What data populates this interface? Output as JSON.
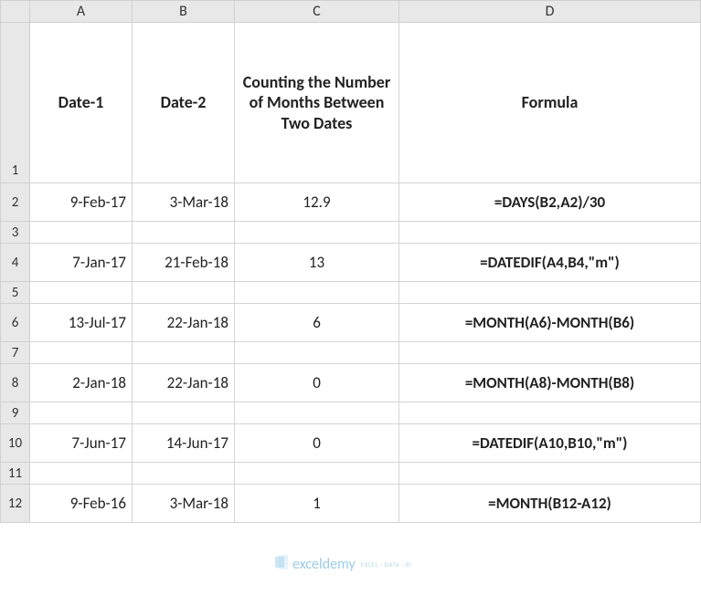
{
  "columns": {
    "rowhead": "",
    "A": "A",
    "B": "B",
    "C": "C",
    "D": "D"
  },
  "header": {
    "A": "Date-1",
    "B": "Date-2",
    "C": "Counting the Number of Months Between Two Dates",
    "D": "Formula"
  },
  "rows": [
    {
      "n": "1",
      "type": "header"
    },
    {
      "n": "2",
      "type": "data",
      "A": "9-Feb-17",
      "B": "3-Mar-18",
      "C": "12.9",
      "D": "=DAYS(B2,A2)/30"
    },
    {
      "n": "3",
      "type": "empty"
    },
    {
      "n": "4",
      "type": "data",
      "A": "7-Jan-17",
      "B": "21-Feb-18",
      "C": "13",
      "D": "=DATEDIF(A4,B4,\"m\")"
    },
    {
      "n": "5",
      "type": "empty"
    },
    {
      "n": "6",
      "type": "data",
      "A": "13-Jul-17",
      "B": "22-Jan-18",
      "C": "6",
      "D": "=MONTH(A6)-MONTH(B6)"
    },
    {
      "n": "7",
      "type": "empty"
    },
    {
      "n": "8",
      "type": "data",
      "A": "2-Jan-18",
      "B": "22-Jan-18",
      "C": "0",
      "D": "=MONTH(A8)-MONTH(B8)"
    },
    {
      "n": "9",
      "type": "empty"
    },
    {
      "n": "10",
      "type": "data",
      "A": "7-Jun-17",
      "B": "14-Jun-17",
      "C": "0",
      "D": "=DATEDIF(A10,B10,\"m\")"
    },
    {
      "n": "11",
      "type": "empty"
    },
    {
      "n": "12",
      "type": "data",
      "A": "9-Feb-16",
      "B": "3-Mar-18",
      "C": "1",
      "D": "=MONTH(B12-A12)"
    }
  ],
  "watermark": {
    "brand": "exceldemy",
    "tag": "EXCEL · DATA · BI"
  },
  "chart_data": {
    "type": "table",
    "title": "Counting the Number of Months Between Two Dates",
    "columns": [
      "Date-1",
      "Date-2",
      "Counting the Number of Months Between Two Dates",
      "Formula"
    ],
    "rows": [
      [
        "9-Feb-17",
        "3-Mar-18",
        12.9,
        "=DAYS(B2,A2)/30"
      ],
      [
        "7-Jan-17",
        "21-Feb-18",
        13,
        "=DATEDIF(A4,B4,\"m\")"
      ],
      [
        "13-Jul-17",
        "22-Jan-18",
        6,
        "=MONTH(A6)-MONTH(B6)"
      ],
      [
        "2-Jan-18",
        "22-Jan-18",
        0,
        "=MONTH(A8)-MONTH(B8)"
      ],
      [
        "7-Jun-17",
        "14-Jun-17",
        0,
        "=DATEDIF(A10,B10,\"m\")"
      ],
      [
        "9-Feb-16",
        "3-Mar-18",
        1,
        "=MONTH(B12-A12)"
      ]
    ]
  }
}
